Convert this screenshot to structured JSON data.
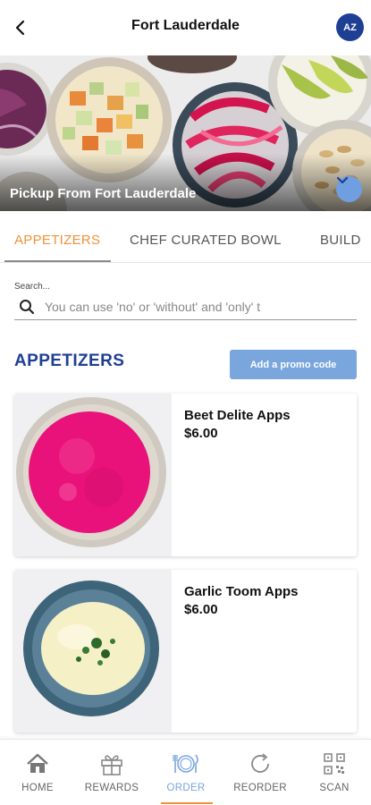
{
  "header": {
    "back_icon": "chevron-left-icon",
    "title": "Fort Lauderdale",
    "avatar_initials": "AZ",
    "avatar_color": "#1f3f95"
  },
  "hero": {
    "pickup_text": "Pickup From Fort Lauderdale",
    "toggle_icon": "chevron-down-icon"
  },
  "tabs": [
    {
      "label": "APPETIZERS",
      "active": true
    },
    {
      "label": "CHEF CURATED BOWL",
      "active": false
    },
    {
      "label": "BUILD",
      "active": false
    }
  ],
  "search": {
    "label": "Search...",
    "placeholder": "You can use 'no' or 'without' and 'only' t",
    "icon": "search-icon"
  },
  "section": {
    "title": "APPETIZERS",
    "promo_button": "Add a promo code"
  },
  "menu_items": [
    {
      "name": "Beet Delite Apps",
      "price": "$6.00"
    },
    {
      "name": "Garlic Toom Apps",
      "price": "$6.00"
    }
  ],
  "bottom_nav": [
    {
      "label": "HOME",
      "icon": "home-icon",
      "active": false
    },
    {
      "label": "REWARDS",
      "icon": "gift-icon",
      "active": false
    },
    {
      "label": "ORDER",
      "icon": "dining-icon",
      "active": true
    },
    {
      "label": "REORDER",
      "icon": "refresh-icon",
      "active": false
    },
    {
      "label": "SCAN",
      "icon": "qr-code-icon",
      "active": false
    }
  ],
  "colors": {
    "accent_orange": "#f0913a",
    "brand_blue": "#1f3f95",
    "button_blue": "#7aa6de"
  }
}
